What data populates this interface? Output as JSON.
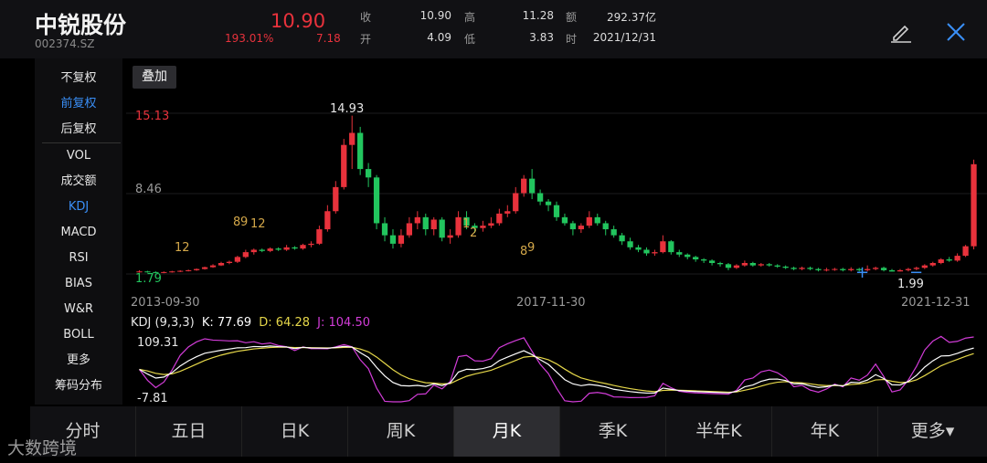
{
  "header": {
    "name": "中锐股份",
    "code": "002374.SZ",
    "price": "10.90",
    "change_pct": "193.01%",
    "change": "7.18",
    "quotes": [
      {
        "label": "收",
        "value": "10.90"
      },
      {
        "label": "高",
        "value": "11.28"
      },
      {
        "label": "额",
        "value": "292.37亿"
      },
      {
        "label": "开",
        "value": "4.09"
      },
      {
        "label": "低",
        "value": "3.83"
      },
      {
        "label": "时",
        "value": "2021/12/31"
      }
    ],
    "edit_icon": "pencil-icon",
    "close_icon": "close-icon"
  },
  "sidebar": {
    "items": [
      "不复权",
      "前复权",
      "后复权",
      "VOL",
      "成交额",
      "KDJ",
      "MACD",
      "RSI",
      "BIAS",
      "W&R",
      "BOLL",
      "更多",
      "筹码分布"
    ],
    "active": [
      "前复权",
      "KDJ"
    ]
  },
  "overlay_button": "叠加",
  "chart_data": {
    "type": "candlestick",
    "period": "月K",
    "x_labels": [
      "2013-09-30",
      "2017-11-30",
      "2021-12-31"
    ],
    "y_labels": {
      "top": "15.13",
      "mid": "8.46",
      "bottom": "1.79"
    },
    "ylim": [
      1.79,
      15.13
    ],
    "annotations": {
      "high": "14.93",
      "low": "1.99"
    },
    "markers": [
      "12",
      "8",
      "9",
      "12",
      "1",
      "2",
      "8",
      "9"
    ],
    "up_color": "#e8323c",
    "down_color": "#22c55e",
    "candles": [
      [
        2.0,
        2.0,
        1.9,
        2.1
      ],
      [
        2.0,
        1.95,
        1.9,
        2.05
      ],
      [
        1.95,
        1.9,
        1.85,
        2.0
      ],
      [
        1.9,
        1.95,
        1.85,
        2.0
      ],
      [
        1.95,
        2.0,
        1.9,
        2.05
      ],
      [
        2.0,
        2.05,
        1.95,
        2.1
      ],
      [
        2.05,
        2.1,
        2.0,
        2.15
      ],
      [
        2.1,
        2.2,
        2.05,
        2.25
      ],
      [
        2.2,
        2.35,
        2.15,
        2.4
      ],
      [
        2.35,
        2.5,
        2.3,
        2.6
      ],
      [
        2.5,
        2.7,
        2.45,
        2.8
      ],
      [
        2.7,
        2.8,
        2.6,
        2.9
      ],
      [
        2.8,
        3.2,
        2.7,
        3.3
      ],
      [
        3.2,
        3.6,
        3.1,
        3.8
      ],
      [
        3.6,
        3.8,
        3.4,
        3.9
      ],
      [
        3.8,
        3.7,
        3.6,
        3.9
      ],
      [
        3.7,
        3.9,
        3.6,
        4.0
      ],
      [
        3.9,
        3.8,
        3.7,
        4.0
      ],
      [
        3.8,
        4.0,
        3.7,
        4.2
      ],
      [
        4.0,
        3.9,
        3.8,
        4.1
      ],
      [
        3.9,
        4.2,
        3.8,
        4.3
      ],
      [
        4.2,
        4.3,
        4.0,
        4.5
      ],
      [
        4.3,
        5.5,
        4.2,
        5.8
      ],
      [
        5.5,
        7.0,
        5.3,
        7.5
      ],
      [
        7.0,
        9.0,
        6.8,
        9.5
      ],
      [
        9.0,
        12.5,
        8.8,
        13.0
      ],
      [
        12.5,
        13.5,
        10.5,
        14.93
      ],
      [
        13.5,
        10.5,
        10.0,
        14.0
      ],
      [
        10.5,
        9.8,
        9.0,
        11.0
      ],
      [
        9.8,
        6.0,
        5.5,
        10.0
      ],
      [
        6.0,
        5.0,
        4.5,
        6.5
      ],
      [
        5.0,
        4.3,
        3.9,
        5.5
      ],
      [
        4.3,
        5.0,
        4.0,
        5.5
      ],
      [
        5.0,
        6.0,
        4.8,
        6.5
      ],
      [
        6.0,
        6.5,
        5.5,
        7.0
      ],
      [
        6.5,
        5.5,
        5.0,
        6.8
      ],
      [
        5.5,
        6.3,
        5.0,
        6.5
      ],
      [
        6.3,
        4.8,
        4.5,
        6.5
      ],
      [
        4.8,
        5.0,
        4.3,
        5.5
      ],
      [
        5.0,
        6.5,
        4.8,
        7.0
      ],
      [
        6.5,
        5.8,
        5.5,
        7.0
      ],
      [
        5.8,
        5.6,
        5.2,
        6.0
      ],
      [
        5.6,
        5.8,
        5.3,
        6.2
      ],
      [
        5.8,
        6.0,
        5.6,
        6.5
      ],
      [
        6.0,
        6.8,
        5.8,
        7.2
      ],
      [
        6.8,
        7.0,
        6.5,
        7.5
      ],
      [
        7.0,
        8.5,
        6.8,
        9.0
      ],
      [
        8.5,
        9.7,
        8.2,
        10.0
      ],
      [
        9.7,
        8.5,
        8.0,
        10.5
      ],
      [
        8.5,
        7.8,
        7.5,
        8.8
      ],
      [
        7.8,
        7.5,
        7.0,
        8.0
      ],
      [
        7.5,
        6.5,
        6.2,
        7.8
      ],
      [
        6.5,
        6.0,
        5.8,
        6.8
      ],
      [
        6.0,
        5.5,
        5.0,
        6.2
      ],
      [
        5.5,
        5.8,
        5.2,
        6.0
      ],
      [
        5.8,
        6.5,
        5.6,
        7.0
      ],
      [
        6.5,
        6.0,
        5.8,
        6.8
      ],
      [
        6.0,
        5.5,
        5.0,
        6.2
      ],
      [
        5.5,
        5.0,
        4.8,
        5.8
      ],
      [
        5.0,
        4.5,
        4.2,
        5.2
      ],
      [
        4.5,
        4.0,
        3.8,
        4.8
      ],
      [
        4.0,
        3.8,
        3.6,
        4.2
      ],
      [
        3.8,
        3.5,
        3.3,
        4.0
      ],
      [
        3.5,
        3.6,
        3.3,
        3.8
      ],
      [
        3.6,
        4.5,
        3.5,
        5.0
      ],
      [
        4.5,
        3.6,
        3.4,
        4.6
      ],
      [
        3.6,
        3.4,
        3.2,
        3.8
      ],
      [
        3.4,
        3.2,
        3.0,
        3.5
      ],
      [
        3.2,
        3.0,
        2.8,
        3.3
      ],
      [
        3.0,
        2.9,
        2.7,
        3.1
      ],
      [
        2.9,
        2.7,
        2.5,
        3.0
      ],
      [
        2.7,
        2.6,
        2.4,
        2.8
      ],
      [
        2.6,
        2.3,
        2.1,
        2.7
      ],
      [
        2.3,
        2.5,
        2.2,
        2.6
      ],
      [
        2.5,
        2.7,
        2.4,
        2.9
      ],
      [
        2.7,
        2.5,
        2.4,
        2.8
      ],
      [
        2.5,
        2.6,
        2.4,
        2.7
      ],
      [
        2.6,
        2.5,
        2.4,
        2.7
      ],
      [
        2.5,
        2.4,
        2.3,
        2.6
      ],
      [
        2.4,
        2.3,
        2.2,
        2.5
      ],
      [
        2.3,
        2.2,
        2.1,
        2.4
      ],
      [
        2.2,
        2.3,
        2.1,
        2.4
      ],
      [
        2.3,
        2.2,
        2.1,
        2.4
      ],
      [
        2.2,
        2.1,
        2.0,
        2.3
      ],
      [
        2.1,
        2.15,
        2.0,
        2.3
      ],
      [
        2.15,
        2.2,
        2.05,
        2.3
      ],
      [
        2.2,
        2.1,
        2.0,
        2.3
      ],
      [
        2.1,
        2.2,
        2.0,
        2.35
      ],
      [
        2.2,
        2.1,
        2.0,
        2.3
      ],
      [
        2.1,
        2.2,
        2.0,
        2.5
      ],
      [
        2.2,
        2.3,
        2.1,
        2.4
      ],
      [
        2.3,
        2.1,
        2.0,
        2.4
      ],
      [
        2.1,
        1.99,
        1.99,
        2.2
      ],
      [
        2.0,
        2.1,
        1.99,
        2.2
      ],
      [
        2.1,
        2.2,
        2.0,
        2.3
      ],
      [
        2.2,
        2.3,
        2.1,
        2.4
      ],
      [
        2.3,
        2.5,
        2.2,
        2.6
      ],
      [
        2.5,
        2.7,
        2.4,
        2.8
      ],
      [
        2.7,
        3.0,
        2.6,
        3.1
      ],
      [
        3.0,
        2.9,
        2.8,
        3.2
      ],
      [
        2.9,
        3.3,
        2.8,
        3.5
      ],
      [
        3.3,
        4.09,
        3.2,
        4.2
      ],
      [
        4.09,
        10.9,
        3.83,
        11.28
      ]
    ],
    "kdj": {
      "params": "KDJ (9,3,3)",
      "K": "K: 77.69",
      "D": "D: 64.28",
      "J": "J: 104.50",
      "y_top": "109.31",
      "y_bottom": "-7.81",
      "colors": {
        "K": "#ffffff",
        "D": "#e6d84a",
        "J": "#d23cd8"
      }
    }
  },
  "tabs": [
    "分时",
    "五日",
    "日K",
    "周K",
    "月K",
    "季K",
    "半年K",
    "年K",
    "更多▾"
  ],
  "active_tab": "月K",
  "watermark": "大数跨境"
}
